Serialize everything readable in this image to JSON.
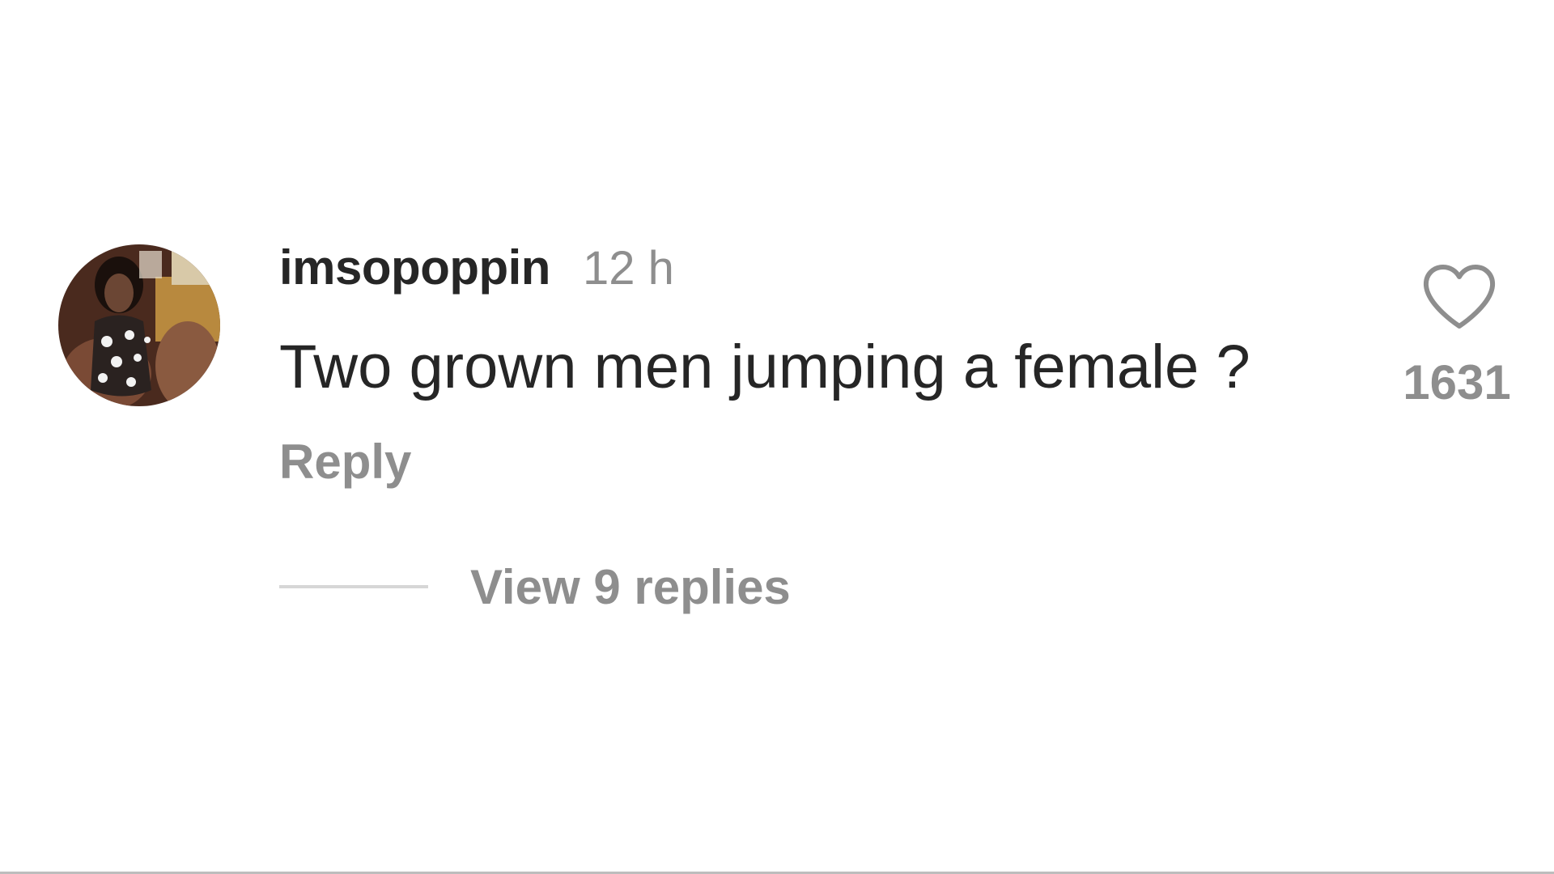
{
  "comment": {
    "username": "imsopoppin",
    "timestamp": "12 h",
    "text": "Two grown men jumping a female ?",
    "reply_label": "Reply",
    "view_replies_label": "View 9 replies",
    "like_count": "1631"
  },
  "icons": {
    "like": "heart-outline-icon",
    "avatar": "profile-photo"
  },
  "colors": {
    "primary_text": "#262626",
    "secondary_text": "#8e8e8e",
    "divider": "#d6d6d6",
    "background": "#ffffff"
  }
}
